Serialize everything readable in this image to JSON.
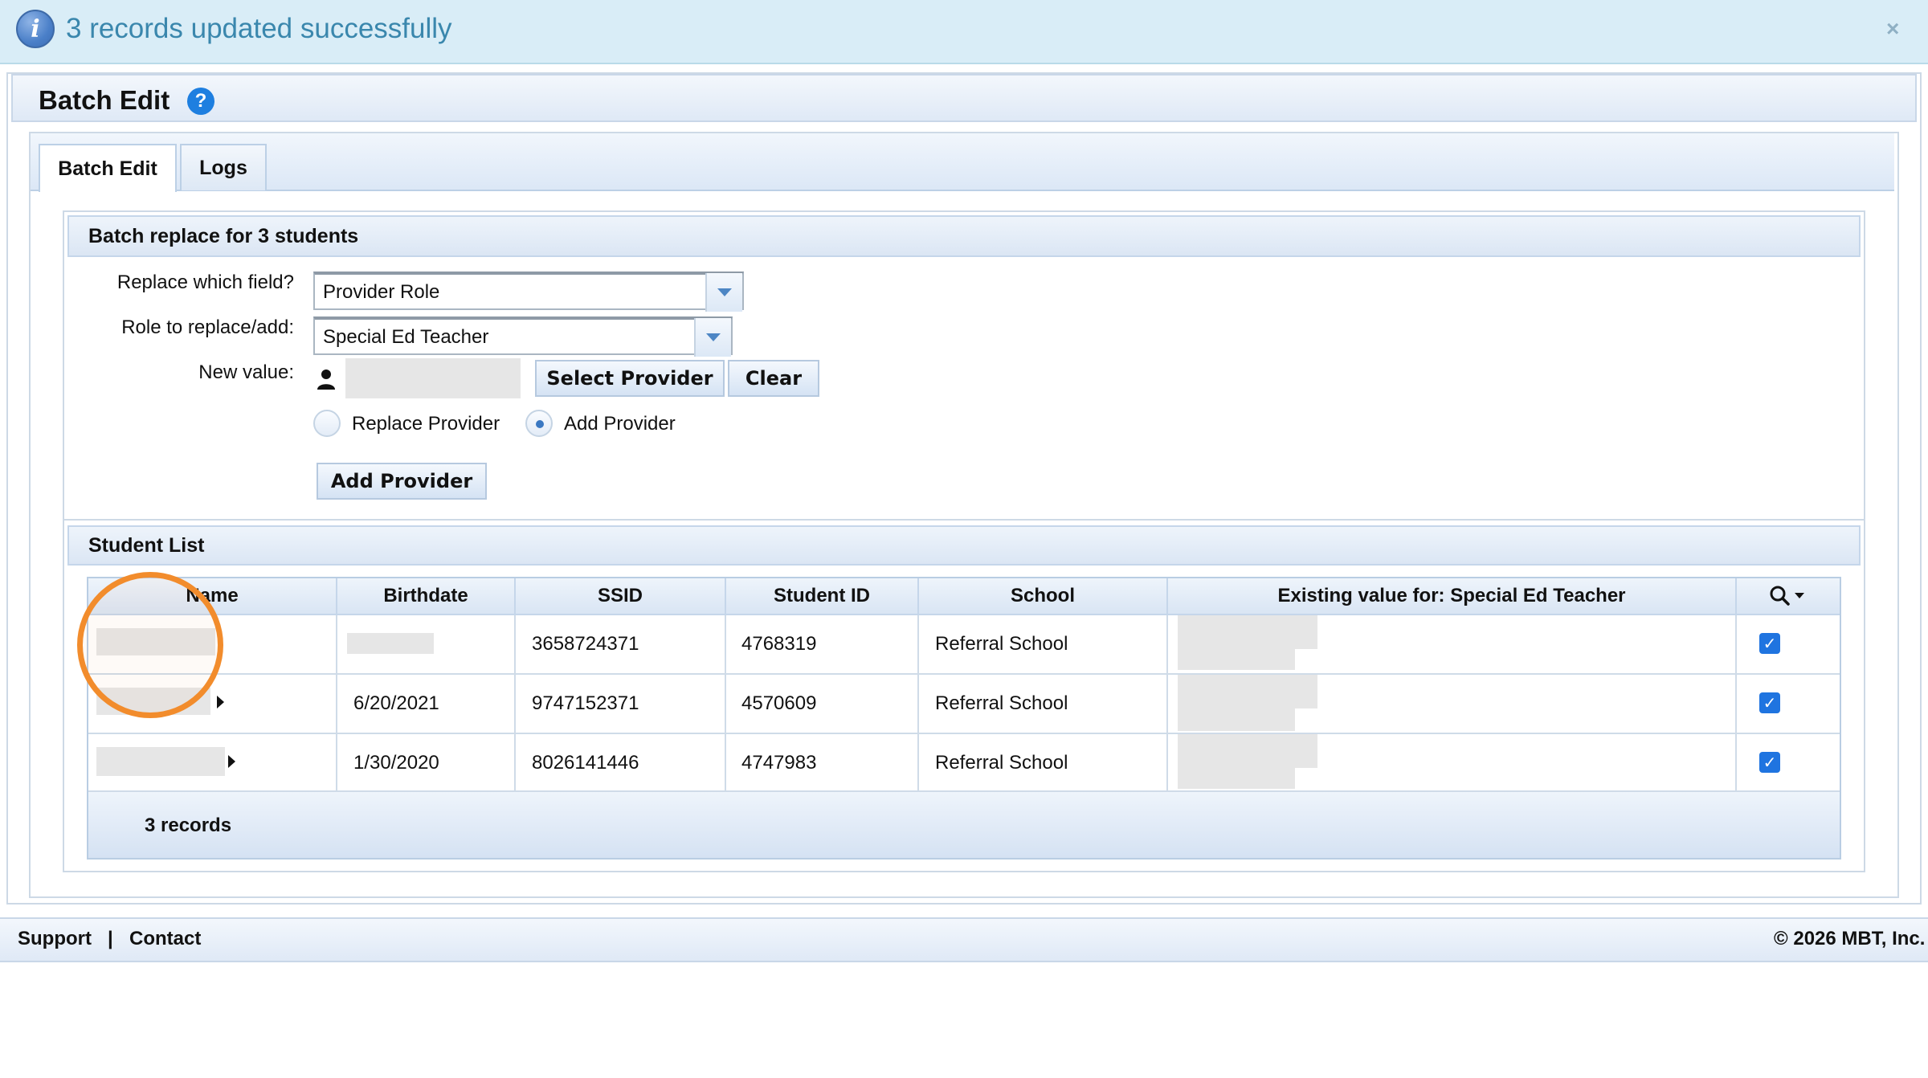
{
  "banner": {
    "message": "3 records updated successfully",
    "icon": "info-icon",
    "close_label": "×"
  },
  "panel": {
    "title": "Batch Edit",
    "help_label": "?"
  },
  "tabs": [
    {
      "label": "Batch Edit",
      "active": true
    },
    {
      "label": "Logs",
      "active": false
    }
  ],
  "batch_replace": {
    "header": "Batch replace for 3 students",
    "field_label": "Replace which field?",
    "field_value": "Provider Role",
    "role_label": "Role to replace/add:",
    "role_value": "Special Ed Teacher",
    "new_value_label": "New value:",
    "select_provider_button": "Select Provider",
    "clear_button": "Clear",
    "radio_options": [
      {
        "label": "Replace Provider",
        "checked": false
      },
      {
        "label": "Add Provider",
        "checked": true
      }
    ],
    "add_provider_button": "Add Provider"
  },
  "student_list": {
    "header": "Student List",
    "columns": [
      "Name",
      "Birthdate",
      "SSID",
      "Student ID",
      "School",
      "Existing value for: Special Ed Teacher"
    ],
    "rows": [
      {
        "birthdate": "",
        "ssid": "3658724371",
        "student_id": "4768319",
        "school": "Referral School",
        "selected": true
      },
      {
        "birthdate": "6/20/2021",
        "ssid": "9747152371",
        "student_id": "4570609",
        "school": "Referral School",
        "selected": true
      },
      {
        "birthdate": "1/30/2020",
        "ssid": "8026141446",
        "student_id": "4747983",
        "school": "Referral School",
        "selected": true
      }
    ],
    "record_count": "3 records",
    "tools_icon": "search-icon"
  },
  "footer": {
    "support": "Support",
    "separator": "|",
    "contact": "Contact",
    "copyright": "© 2026 MBT, Inc."
  },
  "colors": {
    "banner_bg": "#d9edf7",
    "banner_text": "#3a87ad",
    "header_gradient_top": "#eef4fb",
    "header_gradient_bottom": "#d9e5f4",
    "checkbox": "#1f74e0",
    "highlight": "#f28c2c"
  }
}
